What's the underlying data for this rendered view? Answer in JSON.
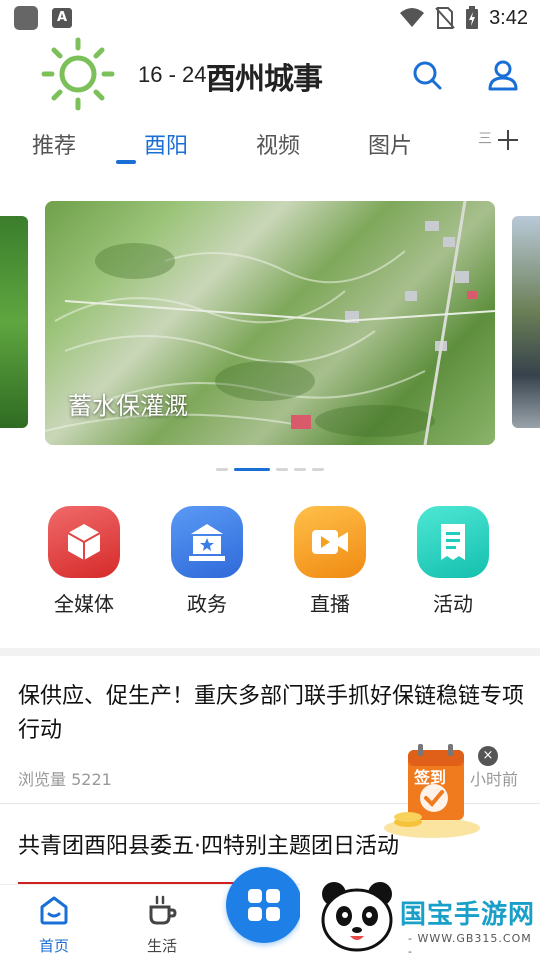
{
  "status_bar": {
    "time": "3:42",
    "app_badge": "A",
    "icons": [
      "gallery-app-icon",
      "a-app-icon",
      "wifi-icon",
      "no-sim-icon",
      "battery-charging-icon"
    ]
  },
  "header": {
    "weather_icon": "sun-icon",
    "temperature": "16 - 24",
    "brand": "酉州城事",
    "icons": [
      "search-icon",
      "user-icon"
    ]
  },
  "tabs": {
    "items": [
      {
        "label": "推荐",
        "active": false
      },
      {
        "label": "酉阳",
        "active": true
      },
      {
        "label": "视频",
        "active": false
      },
      {
        "label": "图片",
        "active": false
      }
    ],
    "overflow_label": "三",
    "add_icon": "plus-icon"
  },
  "carousel": {
    "caption": "蓄水保灌溉",
    "active_index": 1,
    "slide_count": 6
  },
  "quick_entries": [
    {
      "label": "全媒体",
      "icon": "cube-icon",
      "color": "#e63a3a"
    },
    {
      "label": "政务",
      "icon": "government-icon",
      "color": "#3a7de6"
    },
    {
      "label": "直播",
      "icon": "video-camera-icon",
      "color": "#f5a21a"
    },
    {
      "label": "活动",
      "icon": "document-icon",
      "color": "#1fcdbc"
    }
  ],
  "news": [
    {
      "title": "保供应、促生产！重庆多部门联手抓好保链稳链专项行动",
      "views": "浏览量 5221",
      "time": "小时前"
    },
    {
      "title": "共青团酉阳县委五·四特别主题团日活动"
    }
  ],
  "signin_badge": {
    "label": "签到",
    "close": "×"
  },
  "bottom_nav": {
    "items": [
      {
        "label": "首页",
        "icon": "home-icon",
        "active": true
      },
      {
        "label": "生活",
        "icon": "coffee-cup-icon",
        "active": false
      }
    ],
    "center_icon": "apps-grid-icon"
  },
  "watermark": {
    "text": "国宝手游网",
    "url": "- WWW.GB315.COM -"
  },
  "colors": {
    "accent": "#1a6fd6",
    "news_accent": "#d02020"
  }
}
